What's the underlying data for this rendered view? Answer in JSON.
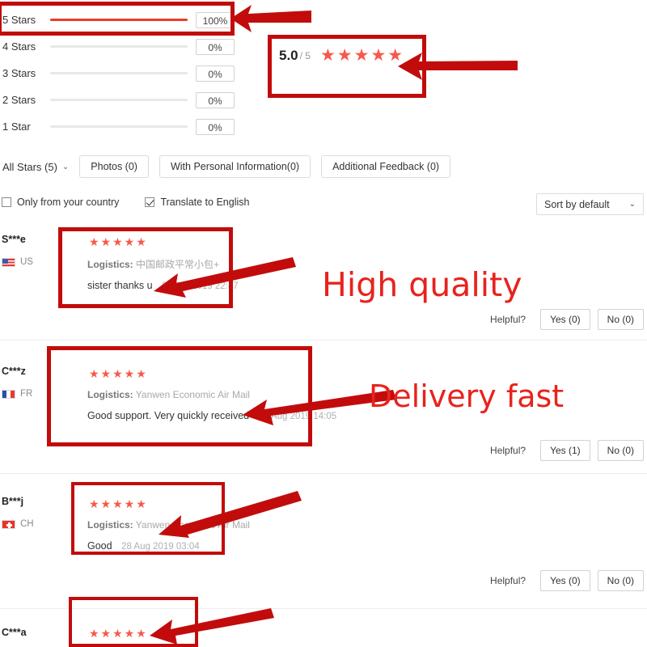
{
  "rating_histogram": {
    "rows": [
      {
        "label": "5 Stars",
        "percent_label": "100%",
        "percent": 100
      },
      {
        "label": "4 Stars",
        "percent_label": "0%",
        "percent": 0
      },
      {
        "label": "3 Stars",
        "percent_label": "0%",
        "percent": 0
      },
      {
        "label": "2 Stars",
        "percent_label": "0%",
        "percent": 0
      },
      {
        "label": "1 Star",
        "percent_label": "0%",
        "percent": 0
      }
    ]
  },
  "overall": {
    "score": "5.0",
    "denominator": "/ 5",
    "stars": "★★★★★"
  },
  "filters": {
    "all_stars_label": "All Stars (5)",
    "chevron": "⌄",
    "tabs": [
      {
        "label": "Photos (0)"
      },
      {
        "label": "With Personal Information(0)"
      },
      {
        "label": "Additional Feedback (0)"
      }
    ]
  },
  "options": {
    "only_country_label": "Only from your country",
    "only_country_checked": false,
    "translate_label": "Translate to English",
    "translate_checked": true,
    "sort_label": "Sort by default",
    "sort_chevron": "⌄"
  },
  "reviews": [
    {
      "user": "S***e",
      "country_code": "US",
      "flag": "us-flag-icon",
      "stars": "★★★★★",
      "logistics_label": "Logistics:",
      "logistics_value": "中国邮政平常小包+",
      "text": "sister thanks u",
      "date": "01 Oct 2019 22:47",
      "helpful_label": "Helpful?",
      "yes_label": "Yes (0)",
      "no_label": "No (0)"
    },
    {
      "user": "C***z",
      "country_code": "FR",
      "flag": "fr-flag-icon",
      "stars": "★★★★★",
      "logistics_label": "Logistics:",
      "logistics_value": "Yanwen Economic Air Mail",
      "text": "Good support. Very quickly received",
      "date": "16 Aug 2019 14:05",
      "helpful_label": "Helpful?",
      "yes_label": "Yes (1)",
      "no_label": "No (0)"
    },
    {
      "user": "B***j",
      "country_code": "CH",
      "flag": "ch-flag-icon",
      "stars": "★★★★★",
      "logistics_label": "Logistics:",
      "logistics_value": "Yanwen Economic Air Mail",
      "text": "Good",
      "date": "28 Aug 2019 03:04",
      "helpful_label": "Helpful?",
      "yes_label": "Yes (0)",
      "no_label": "No (0)"
    },
    {
      "user": "C***a",
      "country_code": "",
      "flag": "",
      "stars": "★★★★★",
      "logistics_label": "",
      "logistics_value": "",
      "text": "",
      "date": "",
      "helpful_label": "",
      "yes_label": "",
      "no_label": ""
    }
  ],
  "annotations": {
    "color": "#c20c0c",
    "text_color": "#e8221c",
    "callout_high_quality": "High quality",
    "callout_delivery_fast": "Delivery fast"
  }
}
